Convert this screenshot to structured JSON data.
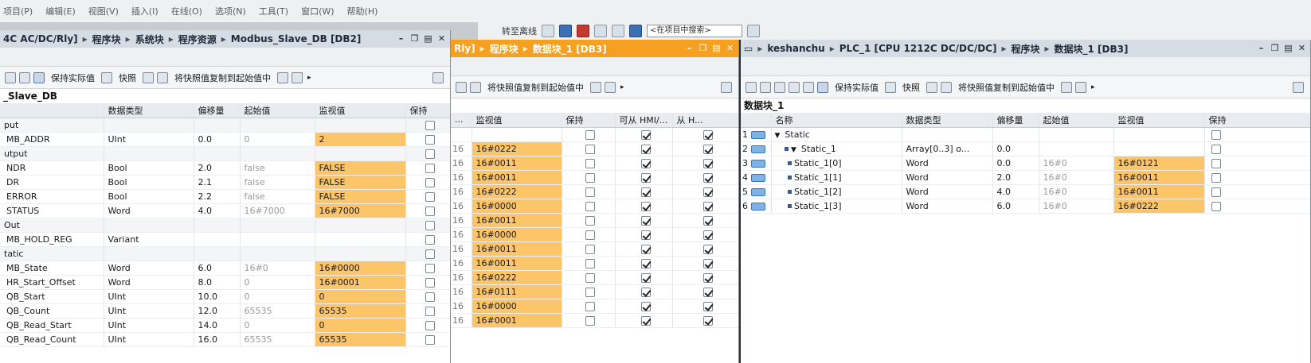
{
  "menu": [
    "项目(P)",
    "编辑(E)",
    "视图(V)",
    "插入(I)",
    "在线(O)",
    "选项(N)",
    "工具(T)",
    "窗口(W)",
    "帮助(H)"
  ],
  "toolbar": {
    "offline_label": "转至离线",
    "search_placeholder": "<在项目中搜索>"
  },
  "left": {
    "title": [
      "4C AC/DC/Rly]",
      "程序块",
      "系统块",
      "程序资源",
      "Modbus_Slave_DB [DB2]"
    ],
    "tools": {
      "keep_label": "保持实际值",
      "snapshot_label": "快照",
      "copy_label": "将快照值复制到起始值中"
    },
    "db_name": "_Slave_DB",
    "headers": [
      "",
      "数据类型",
      "偏移量",
      "起始值",
      "监视值",
      "保持"
    ],
    "rows": [
      {
        "name": "put",
        "type": "",
        "offset": "",
        "start": "",
        "mon": "",
        "keep": false
      },
      {
        "name": "MB_ADDR",
        "type": "UInt",
        "offset": "0.0",
        "start": "0",
        "mon": "2",
        "keep": false
      },
      {
        "name": "utput",
        "type": "",
        "offset": "",
        "start": "",
        "mon": "",
        "keep": false
      },
      {
        "name": "NDR",
        "type": "Bool",
        "offset": "2.0",
        "start": "false",
        "mon": "FALSE",
        "keep": false
      },
      {
        "name": "DR",
        "type": "Bool",
        "offset": "2.1",
        "start": "false",
        "mon": "FALSE",
        "keep": false
      },
      {
        "name": "ERROR",
        "type": "Bool",
        "offset": "2.2",
        "start": "false",
        "mon": "FALSE",
        "keep": false
      },
      {
        "name": "STATUS",
        "type": "Word",
        "offset": "4.0",
        "start": "16#7000",
        "mon": "16#7000",
        "keep": false
      },
      {
        "name": "Out",
        "type": "",
        "offset": "",
        "start": "",
        "mon": "",
        "keep": false
      },
      {
        "name": "MB_HOLD_REG",
        "type": "Variant",
        "offset": "",
        "start": "",
        "mon": "",
        "keep": false
      },
      {
        "name": "tatic",
        "type": "",
        "offset": "",
        "start": "",
        "mon": "",
        "keep": false
      },
      {
        "name": "MB_State",
        "type": "Word",
        "offset": "6.0",
        "start": "16#0",
        "mon": "16#0000",
        "keep": false
      },
      {
        "name": "HR_Start_Offset",
        "type": "Word",
        "offset": "8.0",
        "start": "0",
        "mon": "16#0001",
        "keep": false
      },
      {
        "name": "QB_Start",
        "type": "UInt",
        "offset": "10.0",
        "start": "0",
        "mon": "0",
        "keep": false
      },
      {
        "name": "QB_Count",
        "type": "UInt",
        "offset": "12.0",
        "start": "65535",
        "mon": "65535",
        "keep": false
      },
      {
        "name": "QB_Read_Start",
        "type": "UInt",
        "offset": "14.0",
        "start": "0",
        "mon": "0",
        "keep": false
      },
      {
        "name": "QB_Read_Count",
        "type": "UInt",
        "offset": "16.0",
        "start": "65535",
        "mon": "65535",
        "keep": false
      }
    ]
  },
  "middle": {
    "title": [
      "Rly]",
      "程序块",
      "数据块_1 [DB3]"
    ],
    "tools": {
      "copy_label": "将快照值复制到起始值中"
    },
    "headers": [
      "...",
      "监视值",
      "保持",
      "可从 HMI/...",
      "从 H..."
    ],
    "rows": [
      {
        "off": "",
        "mon": "",
        "keep": false,
        "hmi": true,
        "fromh": true
      },
      {
        "off": "16",
        "mon": "16#0222",
        "keep": false,
        "hmi": true,
        "fromh": true
      },
      {
        "off": "16",
        "mon": "16#0011",
        "keep": false,
        "hmi": true,
        "fromh": true
      },
      {
        "off": "16",
        "mon": "16#0011",
        "keep": false,
        "hmi": true,
        "fromh": true
      },
      {
        "off": "16",
        "mon": "16#0222",
        "keep": false,
        "hmi": true,
        "fromh": true
      },
      {
        "off": "16",
        "mon": "16#0000",
        "keep": false,
        "hmi": true,
        "fromh": true
      },
      {
        "off": "16",
        "mon": "16#0011",
        "keep": false,
        "hmi": true,
        "fromh": true
      },
      {
        "off": "16",
        "mon": "16#0000",
        "keep": false,
        "hmi": true,
        "fromh": true
      },
      {
        "off": "16",
        "mon": "16#0011",
        "keep": false,
        "hmi": true,
        "fromh": true
      },
      {
        "off": "16",
        "mon": "16#0011",
        "keep": false,
        "hmi": true,
        "fromh": true
      },
      {
        "off": "16",
        "mon": "16#0222",
        "keep": false,
        "hmi": true,
        "fromh": true
      },
      {
        "off": "16",
        "mon": "16#0111",
        "keep": false,
        "hmi": true,
        "fromh": true
      },
      {
        "off": "16",
        "mon": "16#0000",
        "keep": false,
        "hmi": true,
        "fromh": true
      },
      {
        "off": "16",
        "mon": "16#0001",
        "keep": false,
        "hmi": true,
        "fromh": true
      }
    ]
  },
  "right": {
    "title": [
      "keshanchu",
      "PLC_1 [CPU 1212C DC/DC/DC]",
      "程序块",
      "数据块_1 [DB3]"
    ],
    "tools": {
      "keep_label": "保持实际值",
      "snapshot_label": "快照",
      "copy_label": "将快照值复制到起始值中"
    },
    "db_name": "数据块_1",
    "headers": [
      "",
      "名称",
      "数据类型",
      "偏移量",
      "起始值",
      "监视值",
      "保持"
    ],
    "rows": [
      {
        "idx": "1",
        "name": "Static",
        "level": 0,
        "expand": true,
        "type": "",
        "offset": "",
        "start": "",
        "mon": "",
        "keep": false
      },
      {
        "idx": "2",
        "name": "Static_1",
        "level": 1,
        "expand": true,
        "type": "Array[0..3] o...",
        "offset": "0.0",
        "start": "",
        "mon": "",
        "keep": false
      },
      {
        "idx": "3",
        "name": "Static_1[0]",
        "level": 2,
        "expand": false,
        "type": "Word",
        "offset": "0.0",
        "start": "16#0",
        "mon": "16#0121",
        "keep": false
      },
      {
        "idx": "4",
        "name": "Static_1[1]",
        "level": 2,
        "expand": false,
        "type": "Word",
        "offset": "2.0",
        "start": "16#0",
        "mon": "16#0011",
        "keep": false
      },
      {
        "idx": "5",
        "name": "Static_1[2]",
        "level": 2,
        "expand": false,
        "type": "Word",
        "offset": "4.0",
        "start": "16#0",
        "mon": "16#0011",
        "keep": false
      },
      {
        "idx": "6",
        "name": "Static_1[3]",
        "level": 2,
        "expand": false,
        "type": "Word",
        "offset": "6.0",
        "start": "16#0",
        "mon": "16#0222",
        "keep": false
      }
    ]
  }
}
